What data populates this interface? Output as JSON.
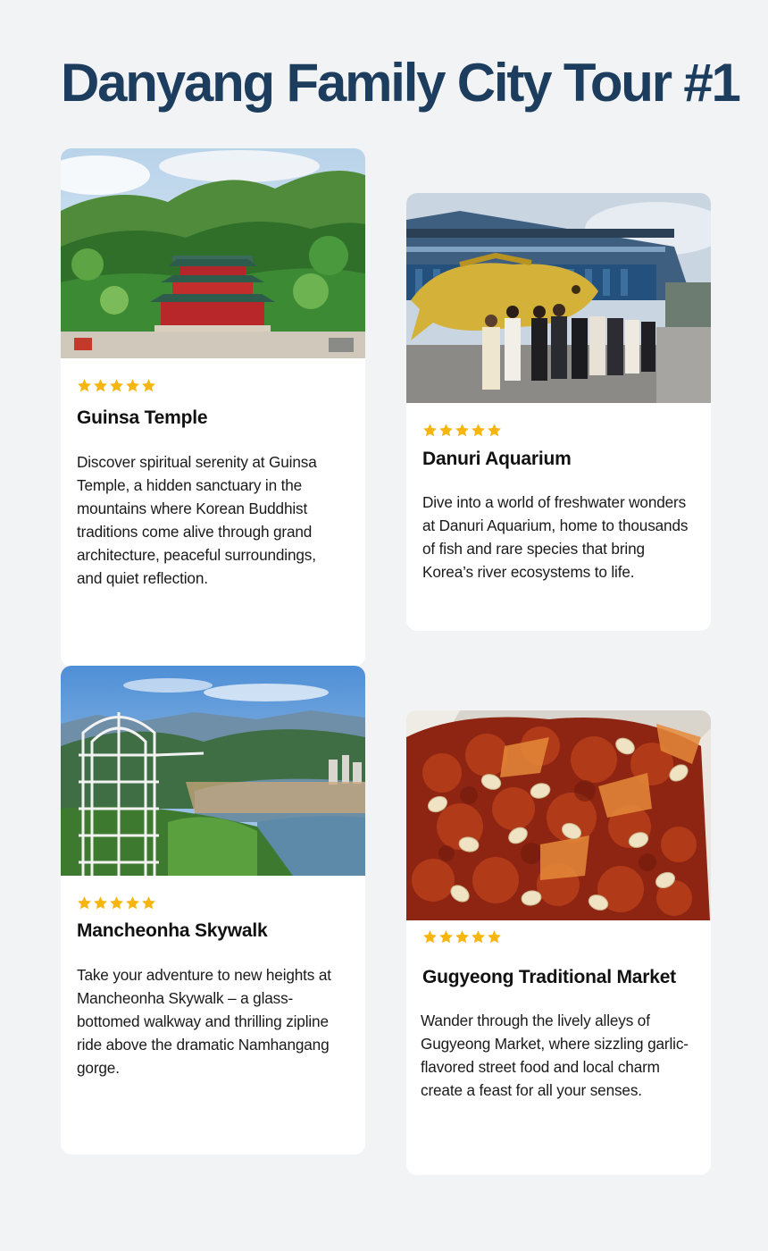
{
  "page": {
    "title": "Danyang Family City Tour #1"
  },
  "colors": {
    "background": "#f2f3f5",
    "title": "#1d3d5e",
    "star": "#f6b50f",
    "card": "#ffffff"
  },
  "attractions": [
    {
      "name": "Guinsa Temple",
      "rating": 5,
      "description": "Discover spiritual serenity at Guinsa Temple, a hidden sanctuary in the mountains where Korean Buddhist traditions come alive through grand architecture, peaceful surroundings, and quiet reflection."
    },
    {
      "name": "Danuri Aquarium",
      "rating": 5,
      "description": "Dive into a world of freshwater wonders at Danuri Aquarium, home to thousands of fish and rare species that bring Korea’s river ecosystems to life."
    },
    {
      "name": "Mancheonha Skywalk",
      "rating": 5,
      "description": "Take your adventure to new heights at Mancheonha Skywalk – a glass-bottomed walkway and thrilling zipline ride above the dramatic Namhangang gorge."
    },
    {
      "name": "Gugyeong Traditional Market",
      "rating": 5,
      "description": "Wander through the lively alleys of Gugyeong Market, where sizzling garlic-flavored street food and local charm create a feast for all your senses."
    }
  ]
}
